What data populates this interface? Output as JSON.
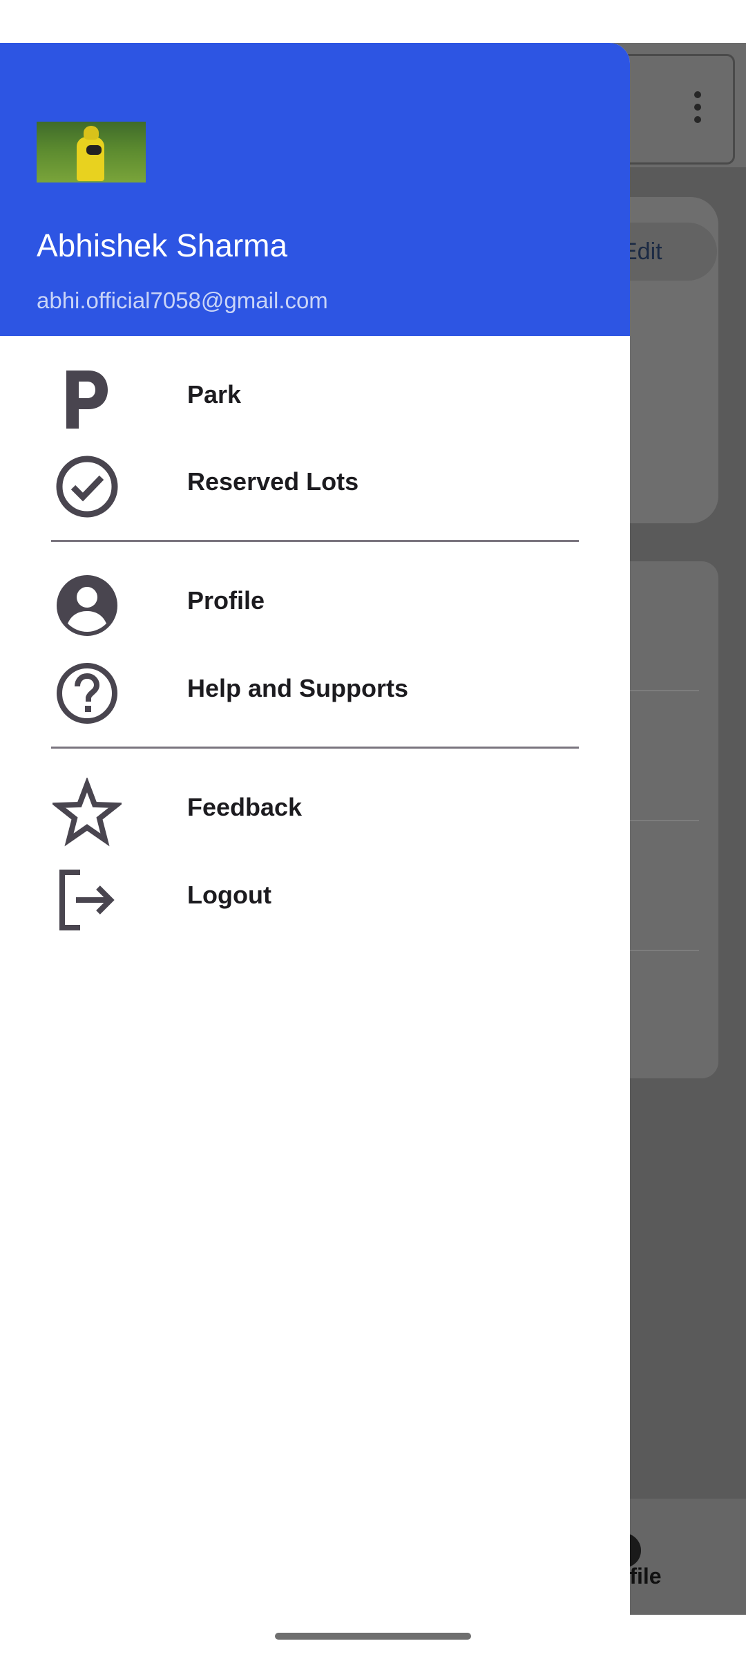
{
  "drawer": {
    "user": {
      "name": "Abhishek Sharma",
      "email": "abhi.official7058@gmail.com"
    },
    "items": [
      {
        "label": "Park",
        "icon": "parking-icon"
      },
      {
        "label": "Reserved Lots",
        "icon": "check-circle-icon"
      },
      {
        "label": "Profile",
        "icon": "account-circle-icon"
      },
      {
        "label": "Help and Supports",
        "icon": "help-circle-icon"
      },
      {
        "label": "Feedback",
        "icon": "star-outline-icon"
      },
      {
        "label": "Logout",
        "icon": "logout-icon"
      }
    ]
  },
  "background_app": {
    "edit_button_label": "Edit",
    "bottom_nav_label": "Profile"
  },
  "colors": {
    "drawer_header": "#2d55e3",
    "scrim": "#5a5a5a",
    "icon": "#49454f"
  }
}
